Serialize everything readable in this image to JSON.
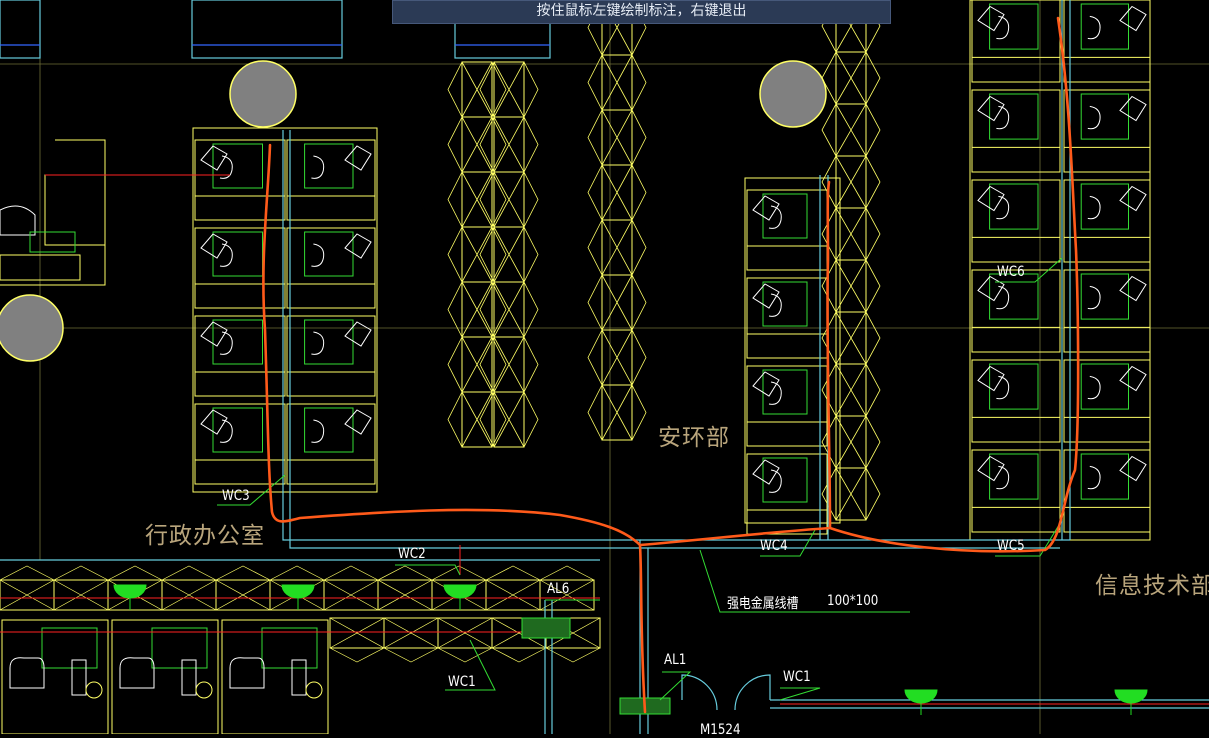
{
  "status_tip": "按住鼠标左键绘制标注，右键退出",
  "rooms": {
    "anhuan": "安环部",
    "xingzheng": "行政办公室",
    "xinxi": "信息技术部"
  },
  "circuit_labels": {
    "wc1_bottom": "WC1",
    "wc1_right": "WC1",
    "wc2": "WC2",
    "wc3": "WC3",
    "wc4": "WC4",
    "wc5": "WC5",
    "wc6": "WC6",
    "al1": "AL1",
    "al6": "AL6",
    "door_tag": "M1524"
  },
  "annotation": {
    "tray_name": "强电金属线槽",
    "tray_size": "100*100"
  },
  "colors": {
    "background": "#000000",
    "furniture": "#ffff66",
    "circuit": "#33dd33",
    "wall": "#66ccdd",
    "markup": "#ff5a1a",
    "power_line": "#ff2222",
    "column": "#888888"
  }
}
